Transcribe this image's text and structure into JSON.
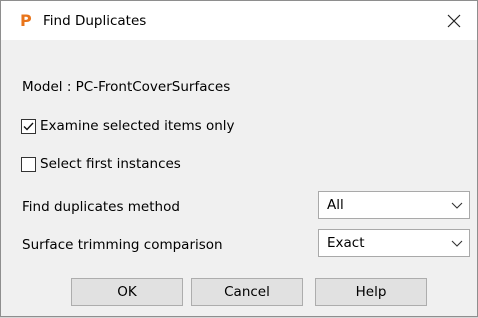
{
  "window": {
    "title": "Find Duplicates",
    "app_icon": "P",
    "close_glyph": "✕"
  },
  "model_label": "Model : PC-FrontCoverSurfaces",
  "options": {
    "examine_selected": {
      "label": "Examine selected items only",
      "checked": true
    },
    "select_first": {
      "label": "Select first instances",
      "checked": false
    }
  },
  "fields": {
    "method": {
      "label": "Find duplicates method",
      "value": "All"
    },
    "trimming": {
      "label": "Surface trimming comparison",
      "value": "Exact"
    }
  },
  "buttons": {
    "ok": "OK",
    "cancel": "Cancel",
    "help": "Help"
  }
}
